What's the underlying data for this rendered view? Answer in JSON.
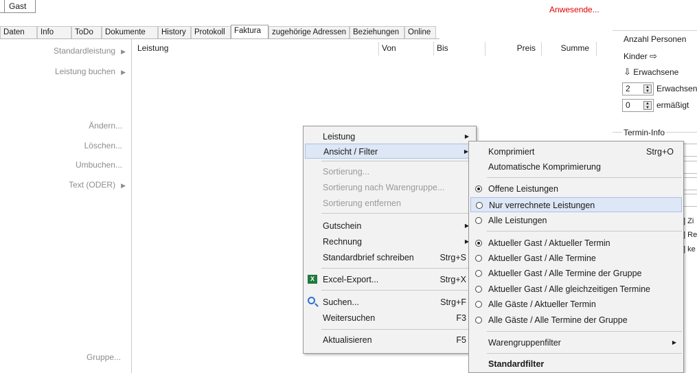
{
  "top": {
    "guest_button": "Gast",
    "present_label": "Anwesende...",
    "present_color": "#e00000"
  },
  "tabs": [
    "Daten",
    "Info",
    "ToDo",
    "Dokumente",
    "History",
    "Protokoll",
    "Faktura",
    "zugehörige Adressen",
    "Beziehungen",
    "Online"
  ],
  "active_tab": "Faktura",
  "left_actions": {
    "standard": "Standardleistung",
    "book": "Leistung buchen",
    "edit": "Ändern...",
    "delete": "Löschen...",
    "rebook": "Umbuchen...",
    "text": "Text (ODER)",
    "group": "Gruppe..."
  },
  "grid": {
    "columns": [
      "Leistung",
      "Von",
      "Bis",
      "Preis",
      "Summe"
    ]
  },
  "right_panel": {
    "persons_title": "Anzahl Personen",
    "children_label": "Kinder",
    "adults_label": "Erwachsene",
    "adults_count": "2",
    "adults_field": "Erwachsene",
    "reduced_count": "0",
    "reduced_field": "ermäßigt",
    "appointment_title": "Termin-Info",
    "clip1": "Zi",
    "clip2": "Re",
    "clip3": "ke"
  },
  "context_menu": {
    "leistung": "Leistung",
    "ansicht": "Ansicht / Filter",
    "sortierung": "Sortierung...",
    "sortierung_waren": "Sortierung nach Warengruppe...",
    "sortierung_entf": "Sortierung entfernen",
    "gutschein": "Gutschein",
    "rechnung": "Rechnung",
    "standardbrief": "Standardbrief schreiben",
    "standardbrief_sc": "Strg+S",
    "excel": "Excel-Export...",
    "excel_sc": "Strg+X",
    "suchen": "Suchen...",
    "suchen_sc": "Strg+F",
    "weitersuchen": "Weitersuchen",
    "weitersuchen_sc": "F3",
    "aktualisieren": "Aktualisieren",
    "aktualisieren_sc": "F5"
  },
  "submenu": {
    "komprimiert": "Komprimiert",
    "komprimiert_sc": "Strg+O",
    "auto_kompr": "Automatische Komprimierung",
    "offene": "Offene Leistungen",
    "verrechnete": "Nur verrechnete Leistungen",
    "alle_leist": "Alle Leistungen",
    "akt_akt": "Aktueller Gast / Aktueller Termin",
    "akt_alle": "Aktueller Gast / Alle Termine",
    "akt_gruppe": "Aktueller Gast / Alle Termine der Gruppe",
    "akt_gleich": "Aktueller Gast / Alle gleichzeitigen Termine",
    "alle_akt": "Alle Gäste / Aktueller Termin",
    "alle_gruppe": "Alle Gäste / Alle Termine der Gruppe",
    "warengruppen": "Warengruppenfilter",
    "standardfilter": "Standardfilter"
  }
}
